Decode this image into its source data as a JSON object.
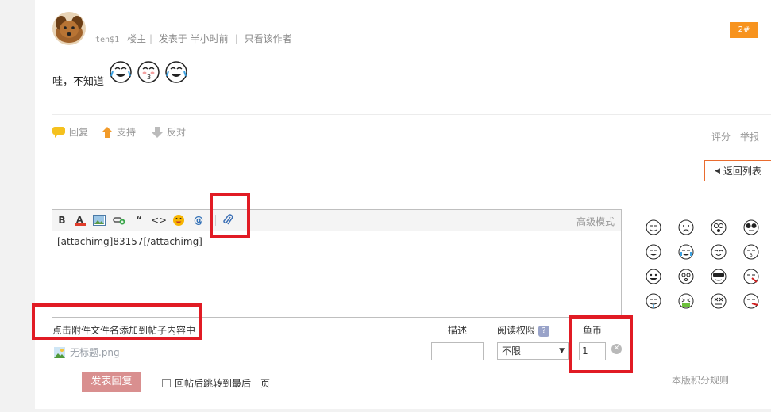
{
  "post": {
    "author": "ten$1",
    "role": "楼主",
    "posted_label": "发表于",
    "time": "半小时前",
    "only_author": "只看该作者",
    "floor": "2#",
    "text": "哇，不知道"
  },
  "actions": {
    "reply": "回复",
    "support": "支持",
    "oppose": "反对",
    "rate": "评分",
    "report": "举报"
  },
  "back_list": "返回列表",
  "editor": {
    "advanced_mode": "高级模式",
    "content": "[attachimg]83157[/attachimg]",
    "toolbar_icons": [
      "bold-icon",
      "font-color-icon",
      "image-icon",
      "link-icon",
      "quote-icon",
      "code-icon",
      "smiley-icon",
      "at-icon",
      "attachment-icon"
    ]
  },
  "attachments": {
    "hint": "点击附件文件名添加到帖子内容中",
    "file_name": "无标题.png",
    "col_desc": "描述",
    "col_permission": "阅读权限",
    "col_coin": "鱼币",
    "permission_value": "不限",
    "coin_value": "1"
  },
  "submit_label": "发表回复",
  "jump_last_label": "回帖后跳转到最后一页",
  "rules_link": "本版积分规则",
  "colors": {
    "accent_orange": "#f7931e",
    "highlight_red": "#e11b24",
    "submit_bg": "#d98f8f"
  }
}
